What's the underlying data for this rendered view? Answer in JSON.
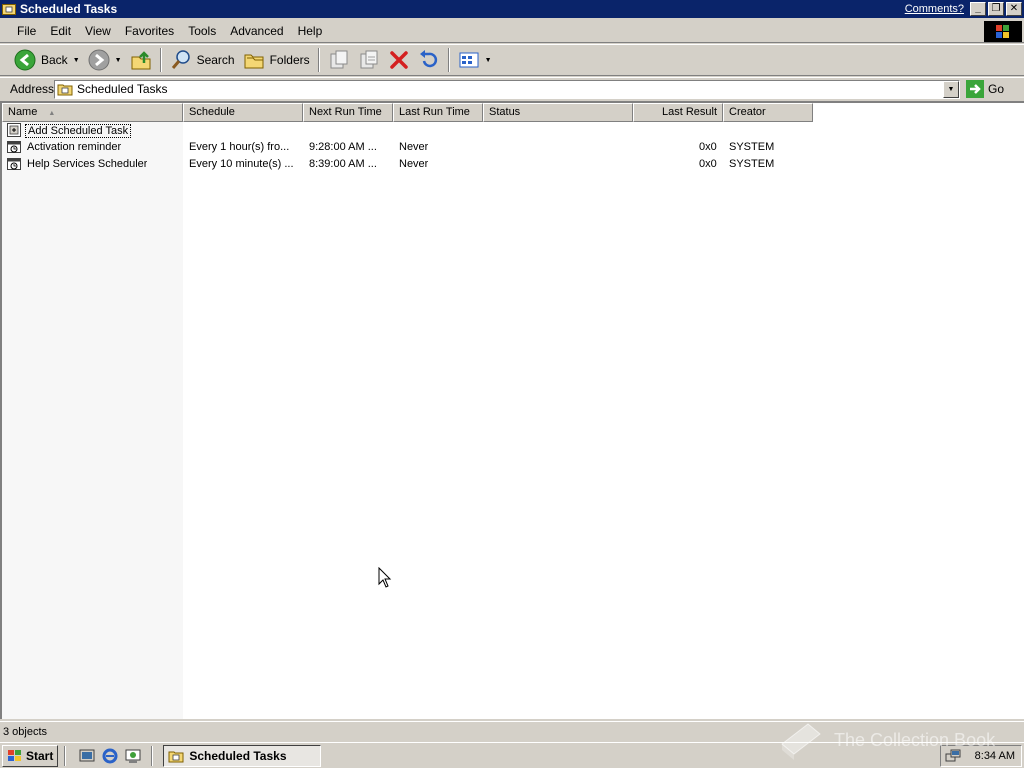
{
  "window": {
    "title": "Scheduled Tasks",
    "comments_link": "Comments?",
    "minimize": "_",
    "maximize": "❐",
    "close": "✕"
  },
  "menu": [
    "File",
    "Edit",
    "View",
    "Favorites",
    "Tools",
    "Advanced",
    "Help"
  ],
  "toolbar": {
    "back_label": "Back",
    "search_label": "Search",
    "folders_label": "Folders",
    "icons": [
      "back-arrow-icon",
      "forward-arrow-icon",
      "up-folder-icon",
      "search-icon",
      "folders-icon",
      "move-to-icon",
      "copy-to-icon",
      "delete-icon",
      "undo-icon",
      "views-icon"
    ]
  },
  "address": {
    "label": "Address",
    "value": "Scheduled Tasks",
    "go_label": "Go"
  },
  "list": {
    "columns": [
      "Name",
      "Schedule",
      "Next Run Time",
      "Last Run Time",
      "Status",
      "Last Result",
      "Creator"
    ],
    "sorted_by": "Name",
    "rows": [
      {
        "name": "Add Scheduled Task",
        "schedule": "",
        "next_run": "",
        "last_run": "",
        "status": "",
        "last_result": "",
        "creator": ""
      },
      {
        "name": "Activation reminder",
        "schedule": "Every 1 hour(s) fro...",
        "next_run": "9:28:00 AM ...",
        "last_run": "Never",
        "status": "",
        "last_result": "0x0",
        "creator": "SYSTEM"
      },
      {
        "name": "Help Services Scheduler",
        "schedule": "Every 10 minute(s) ...",
        "next_run": "8:39:00 AM ...",
        "last_run": "Never",
        "status": "",
        "last_result": "0x0",
        "creator": "SYSTEM"
      }
    ]
  },
  "statusbar": {
    "text": "3 objects"
  },
  "taskbar": {
    "start_label": "Start",
    "task_label": "Scheduled Tasks",
    "clock": "8:34 AM"
  },
  "watermark": "The Collection Book",
  "colors": {
    "titlebar": "#0a246a",
    "face": "#d4d0c8",
    "sort_column": "#f7f7f7",
    "delete_red": "#d42020"
  }
}
